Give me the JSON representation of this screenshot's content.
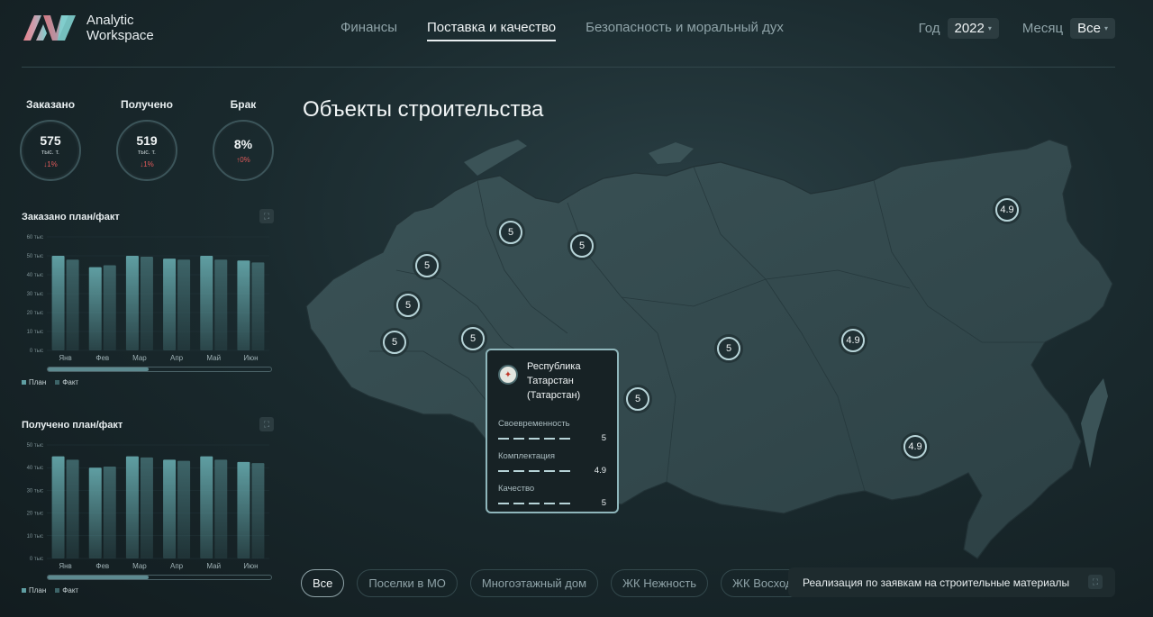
{
  "app": {
    "logo_line1": "Analytic",
    "logo_line2": "Workspace"
  },
  "nav": [
    {
      "label": "Финансы",
      "active": false
    },
    {
      "label": "Поставка и качество",
      "active": true
    },
    {
      "label": "Безопасность и моральный дух",
      "active": false
    }
  ],
  "filters": {
    "year_label": "Год",
    "year_value": "2022",
    "month_label": "Месяц",
    "month_value": "Все"
  },
  "kpis": [
    {
      "title": "Заказано",
      "value": "575",
      "unit": "тыс. т.",
      "delta": "↓1%",
      "tone": "neg"
    },
    {
      "title": "Получено",
      "value": "519",
      "unit": "тыс. т.",
      "delta": "↓1%",
      "tone": "neg"
    },
    {
      "title": "Брак",
      "value": "8%",
      "unit": "",
      "delta": "↑0%",
      "tone": "neg"
    }
  ],
  "colors": {
    "plan": "#5f9ea2",
    "fact": "#3d6468",
    "accent": "#b7d4d8"
  },
  "chart_data": [
    {
      "type": "bar",
      "title": "Заказано план/факт",
      "categories": [
        "Янв",
        "Фев",
        "Мар",
        "Апр",
        "Май",
        "Июн"
      ],
      "y_ticks": [
        "0 тыс",
        "10 тыс",
        "20 тыс",
        "30 тыс",
        "40 тыс",
        "50 тыс",
        "60 тыс"
      ],
      "ylim": [
        0,
        60
      ],
      "series": [
        {
          "name": "План",
          "values": [
            50,
            44,
            50,
            48.5,
            50,
            47.5
          ]
        },
        {
          "name": "Факт",
          "values": [
            48,
            45,
            49.5,
            48,
            48,
            46.5
          ]
        }
      ],
      "legend": "bottom-left"
    },
    {
      "type": "bar",
      "title": "Получено план/факт",
      "categories": [
        "Янв",
        "Фев",
        "Мар",
        "Апр",
        "Май",
        "Июн"
      ],
      "y_ticks": [
        "0 тыс",
        "10 тыс",
        "20 тыс",
        "30 тыс",
        "40 тыс",
        "50 тыс"
      ],
      "ylim": [
        0,
        50
      ],
      "series": [
        {
          "name": "План",
          "values": [
            45,
            40,
            45,
            43.5,
            45,
            42.5
          ]
        },
        {
          "name": "Факт",
          "values": [
            43.5,
            40.5,
            44.5,
            43,
            43.5,
            42
          ]
        }
      ],
      "legend": "bottom-left"
    }
  ],
  "map": {
    "title": "Объекты строительства",
    "markers": [
      "5",
      "5",
      "5",
      "5",
      "5",
      "5",
      "5",
      "5",
      "4.9",
      "4.9",
      "4.9"
    ]
  },
  "tooltip": {
    "region": "Республика Татарстан (Татарстан)",
    "metrics": [
      {
        "label": "Своевременность",
        "value": "5"
      },
      {
        "label": "Комплектация",
        "value": "4.9"
      },
      {
        "label": "Качество",
        "value": "5"
      }
    ]
  },
  "chips": [
    "Все",
    "Поселки в МО",
    "Многоэтажный дом",
    "ЖК Нежность",
    "ЖК Восход"
  ],
  "realization": {
    "label": "Реализация по заявкам на строительные материалы"
  }
}
